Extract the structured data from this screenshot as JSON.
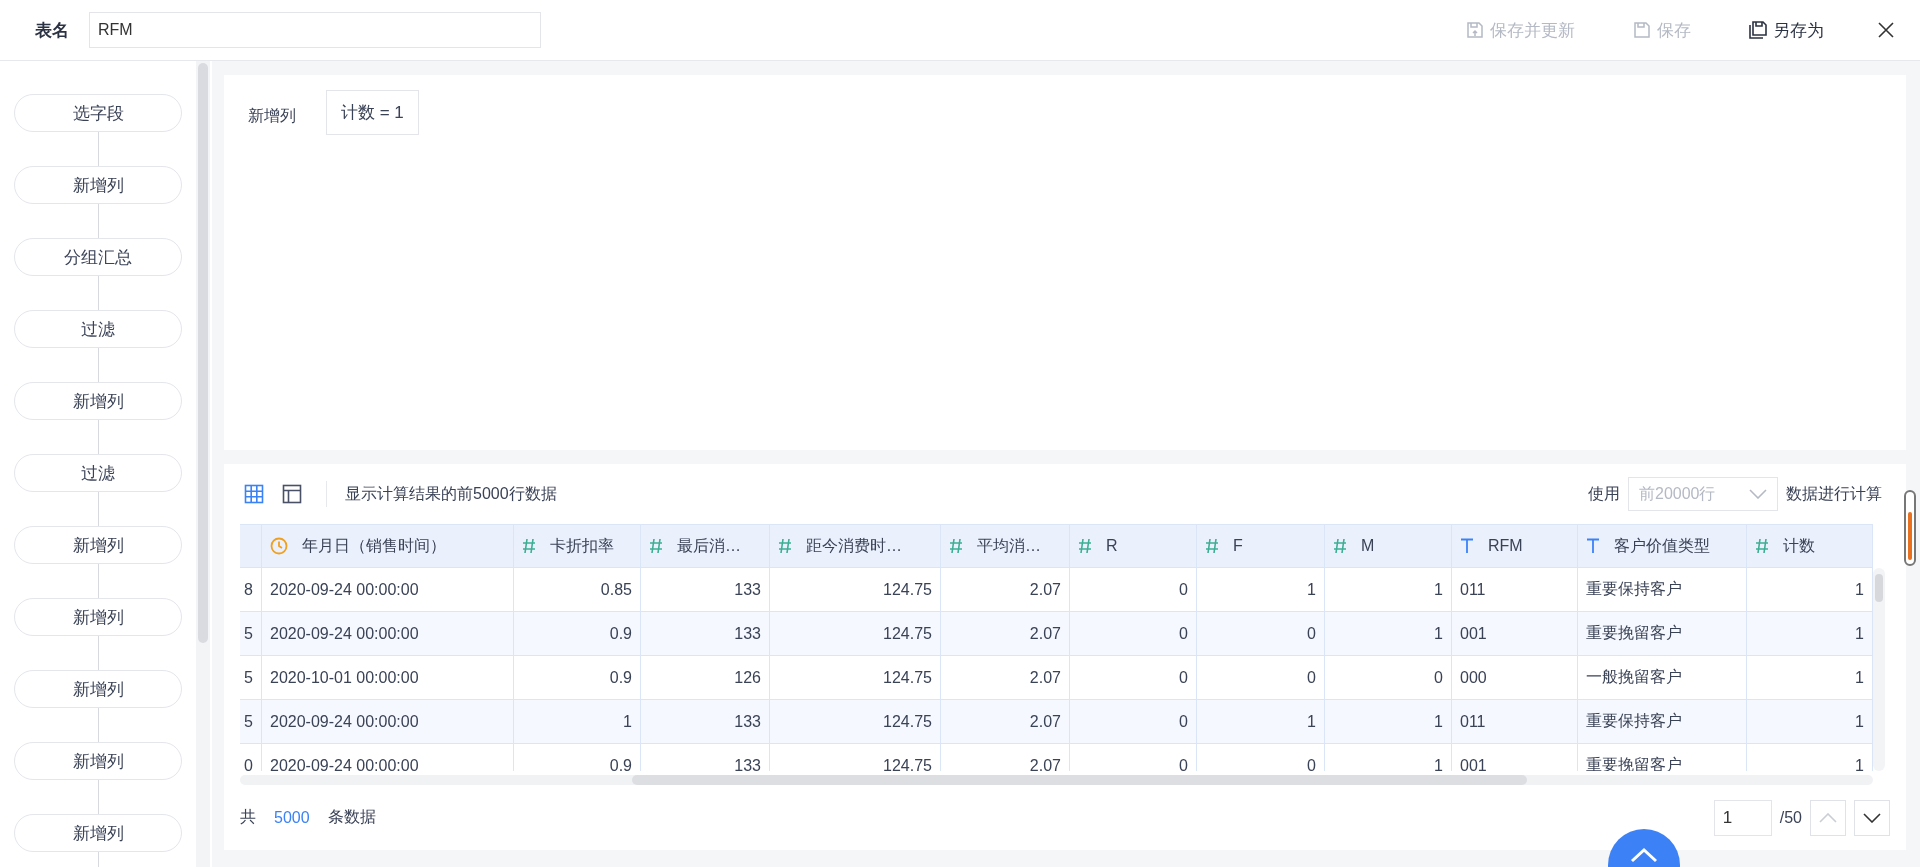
{
  "header": {
    "title_label": "表名",
    "table_name": "RFM",
    "actions": [
      {
        "kind": "save-update",
        "label": "保存并更新",
        "disabled": true
      },
      {
        "kind": "save",
        "label": "保存",
        "disabled": true
      },
      {
        "kind": "save-as",
        "label": "另存为",
        "disabled": false
      }
    ]
  },
  "pipeline": {
    "steps": [
      "选字段",
      "新增列",
      "分组汇总",
      "过滤",
      "新增列",
      "过滤",
      "新增列",
      "新增列",
      "新增列",
      "新增列",
      "新增列"
    ]
  },
  "step_config": {
    "label": "新增列",
    "expression": "计数 = 1"
  },
  "preview": {
    "views": [
      {
        "kind": "grid",
        "selected": true
      },
      {
        "kind": "layout",
        "selected": false
      }
    ],
    "caption": "显示计算结果的前5000行数据",
    "use_label": "使用",
    "row_limit": "前20000行",
    "suffix": "数据进行计算",
    "table": {
      "columns": [
        {
          "kind": "number"
        },
        {
          "kind": "date",
          "label": "年月日（销售时间）"
        },
        {
          "kind": "number",
          "label": "卡折扣率"
        },
        {
          "kind": "number",
          "label": "最后消…"
        },
        {
          "kind": "number",
          "label": "距今消费时…"
        },
        {
          "kind": "number",
          "label": "平均消…"
        },
        {
          "kind": "number",
          "label": "R"
        },
        {
          "kind": "number",
          "label": "F"
        },
        {
          "kind": "number",
          "label": "M"
        },
        {
          "kind": "text",
          "label": "RFM"
        },
        {
          "kind": "text",
          "label": "客户价值类型"
        },
        {
          "kind": "number",
          "label": "计数"
        }
      ],
      "rows": [
        [
          "8",
          "2020-09-24 00:00:00",
          "0.85",
          "133",
          "124.75",
          "2.07",
          "0",
          "1",
          "1",
          "011",
          "重要保持客户",
          "1"
        ],
        [
          "5",
          "2020-09-24 00:00:00",
          "0.9",
          "133",
          "124.75",
          "2.07",
          "0",
          "0",
          "1",
          "001",
          "重要挽留客户",
          "1"
        ],
        [
          "5",
          "2020-10-01 00:00:00",
          "0.9",
          "126",
          "124.75",
          "2.07",
          "0",
          "0",
          "0",
          "000",
          "一般挽留客户",
          "1"
        ],
        [
          "5",
          "2020-09-24 00:00:00",
          "1",
          "133",
          "124.75",
          "2.07",
          "0",
          "1",
          "1",
          "011",
          "重要保持客户",
          "1"
        ],
        [
          "0",
          "2020-09-24 00:00:00",
          "0.9",
          "133",
          "124.75",
          "2.07",
          "0",
          "0",
          "1",
          "001",
          "重要挽留客户",
          "1"
        ]
      ]
    },
    "total_prefix": "共",
    "total": "5000",
    "total_suffix": "条数据",
    "page": "1",
    "page_count": "/50",
    "prev_disabled": true
  }
}
